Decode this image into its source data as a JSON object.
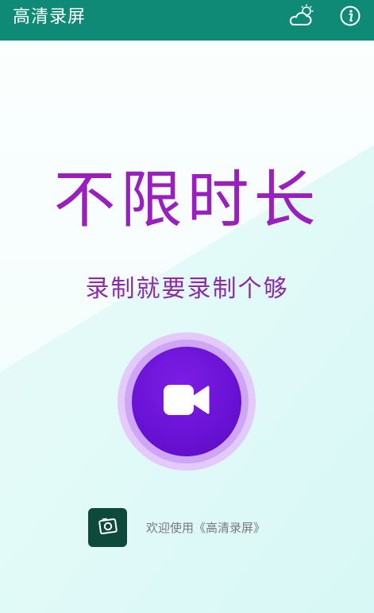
{
  "app_bar": {
    "title": "高清录屏",
    "icons": [
      "weather-settings-icon",
      "info-icon"
    ],
    "color": "#0f8a76"
  },
  "main": {
    "headline": "不限时长",
    "subline": "录制就要录制个够",
    "headline_color": "#9a1fbf",
    "record_button": {
      "icon": "video-camera-icon",
      "color": "#6a12d6"
    }
  },
  "footer": {
    "logo_icon": "camera-logo-icon",
    "welcome_text": "欢迎使用《高清录屏》"
  }
}
